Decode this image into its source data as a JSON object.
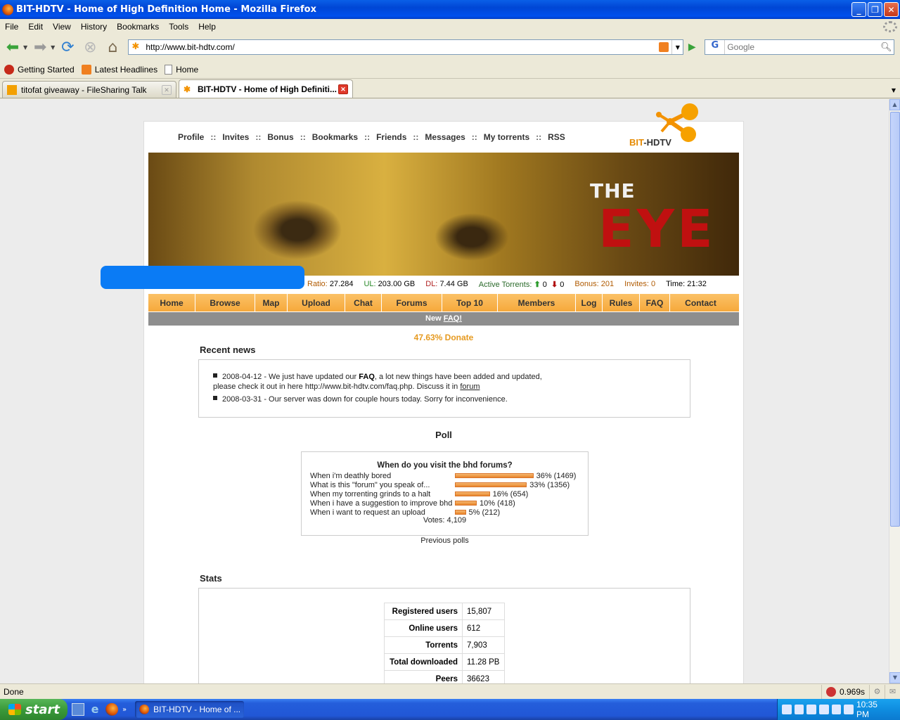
{
  "window": {
    "title": "BIT-HDTV - Home of High Definition Home - Mozilla Firefox"
  },
  "menu": [
    "File",
    "Edit",
    "View",
    "History",
    "Bookmarks",
    "Tools",
    "Help"
  ],
  "nav": {
    "url": "http://www.bit-hdtv.com/",
    "search_placeholder": "Google",
    "search_engine": "G"
  },
  "bookmarks": [
    "Getting Started",
    "Latest Headlines",
    "Home"
  ],
  "tabs": [
    {
      "label": "titofat giveaway - FileSharing Talk",
      "active": false
    },
    {
      "label": "BIT-HDTV - Home of High Definiti...",
      "active": true
    }
  ],
  "site": {
    "topnav": [
      "Profile",
      "Invites",
      "Bonus",
      "Bookmarks",
      "Friends",
      "Messages",
      "My torrents",
      "RSS"
    ],
    "topnav_sep": "::",
    "logo_bit": "BIT",
    "logo_dash": "-HDTV",
    "banner_the": "THE",
    "banner_eye": "EYE",
    "stats": {
      "ratio_label": "Ratio:",
      "ratio": "27.284",
      "ul_label": "UL:",
      "ul": "203.00 GB",
      "dl_label": "DL:",
      "dl": "7.44 GB",
      "active_label": "Active Torrents:",
      "active_up": "0",
      "active_down": "0",
      "bonus_label": "Bonus:",
      "bonus": "201",
      "invites_label": "Invites:",
      "invites": "0",
      "time_label": "Time:",
      "time": "21:32"
    },
    "mainmenu": [
      "Home",
      "Browse",
      "Map",
      "Upload",
      "Chat",
      "Forums",
      "Top 10",
      "Members",
      "Log",
      "Rules",
      "FAQ",
      "Contact"
    ],
    "newfaq_prefix": "New ",
    "newfaq_link": "FAQ!",
    "donate": "47.63% Donate",
    "news_title": "Recent news",
    "news": {
      "item1_pre": "2008-04-12 - We just have updated our ",
      "item1_bold": "FAQ",
      "item1_mid": ", a lot new things have been added and updated,",
      "item1_line2": "please check it out in here http://www.bit-hdtv.com/faq.php. Discuss it in ",
      "item1_link": "forum",
      "item2": "2008-03-31 - Our server was down for couple hours today. Sorry for inconvenience."
    },
    "poll_title": "Poll",
    "poll": {
      "question": "When do you visit the bhd forums?",
      "answers": [
        {
          "text": "When i'm deathly bored",
          "percent": 36,
          "result": "36% (1469)"
        },
        {
          "text": "What is this \"forum\" you speak of...",
          "percent": 33,
          "result": "33% (1356)"
        },
        {
          "text": "When my torrenting grinds to a halt",
          "percent": 16,
          "result": "16% (654)"
        },
        {
          "text": "When i have a suggestion to improve bhd",
          "percent": 10,
          "result": "10% (418)"
        },
        {
          "text": "When i want to request an upload",
          "percent": 5,
          "result": "5% (212)"
        }
      ],
      "votes": "Votes: 4,109",
      "previous": "Previous polls"
    },
    "stats_title": "Stats",
    "stats_table": [
      {
        "k": "Registered users",
        "v": "15,807"
      },
      {
        "k": "Online users",
        "v": "612"
      },
      {
        "k": "Torrents",
        "v": "7,903"
      },
      {
        "k": "Total downloaded",
        "v": "11.28 PB"
      },
      {
        "k": "Peers",
        "v": "36623"
      }
    ]
  },
  "status": {
    "text": "Done",
    "yslow": "0.969s"
  },
  "taskbar": {
    "start": "start",
    "item": "BIT-HDTV - Home of ...",
    "clock": "10:35 PM"
  },
  "colors": {
    "menu_orange": "#f6a93b",
    "donate": "#e69a20",
    "faq_bar": "#8e8e8e",
    "poll_bar": "#e8842a"
  }
}
